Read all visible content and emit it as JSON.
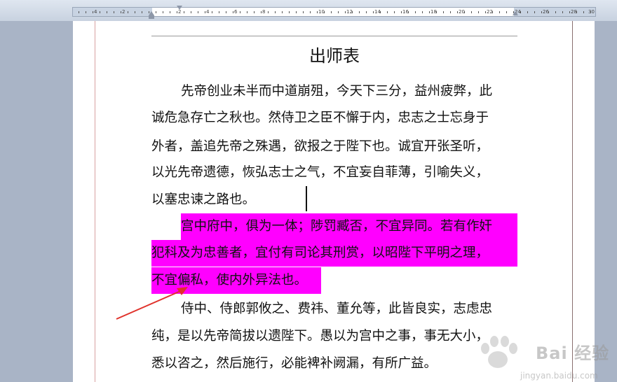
{
  "ruler": {
    "numbers": [
      "4",
      "2",
      "2",
      "4",
      "6",
      "8",
      "10",
      "12",
      "14",
      "16",
      "18",
      "20",
      "22",
      "24",
      "26",
      "28",
      "30"
    ]
  },
  "document": {
    "title": "出师表",
    "paragraph1": [
      "先帝创业未半而中道崩殂，今天下三分，益州疲弊，此",
      "诚危急存亡之秋也。然侍卫之臣不懈于内，忠志之士忘身于",
      "外者，盖追先帝之殊遇，欲报之于陛下也。诚宜开张圣听，",
      "以光先帝遗德，恢弘志士之气，不宜妄自菲薄，引喻失义，",
      "以塞忠谏之路也。"
    ],
    "paragraph2": [
      "宫中府中，俱为一体；陟罚臧否，不宜异同。若有作奸",
      "犯科及为忠善者，宜付有司论其刑赏，以昭陛下平明之理，",
      "不宜偏私，使内外异法也。"
    ],
    "paragraph3": [
      "侍中、侍郎郭攸之、费祎、董允等，此皆良实，志虑忠",
      "纯，是以先帝简拔以遗陛下。愚以为宫中之事，事无大小，",
      "悉以咨之，然后施行，必能裨补阙漏，有所广益。"
    ]
  },
  "highlight_color": "#ff00ff",
  "arrow_color": "#e0322b",
  "watermark": {
    "brand": "Bai 经验",
    "url": "jingyan.baidu.com"
  }
}
